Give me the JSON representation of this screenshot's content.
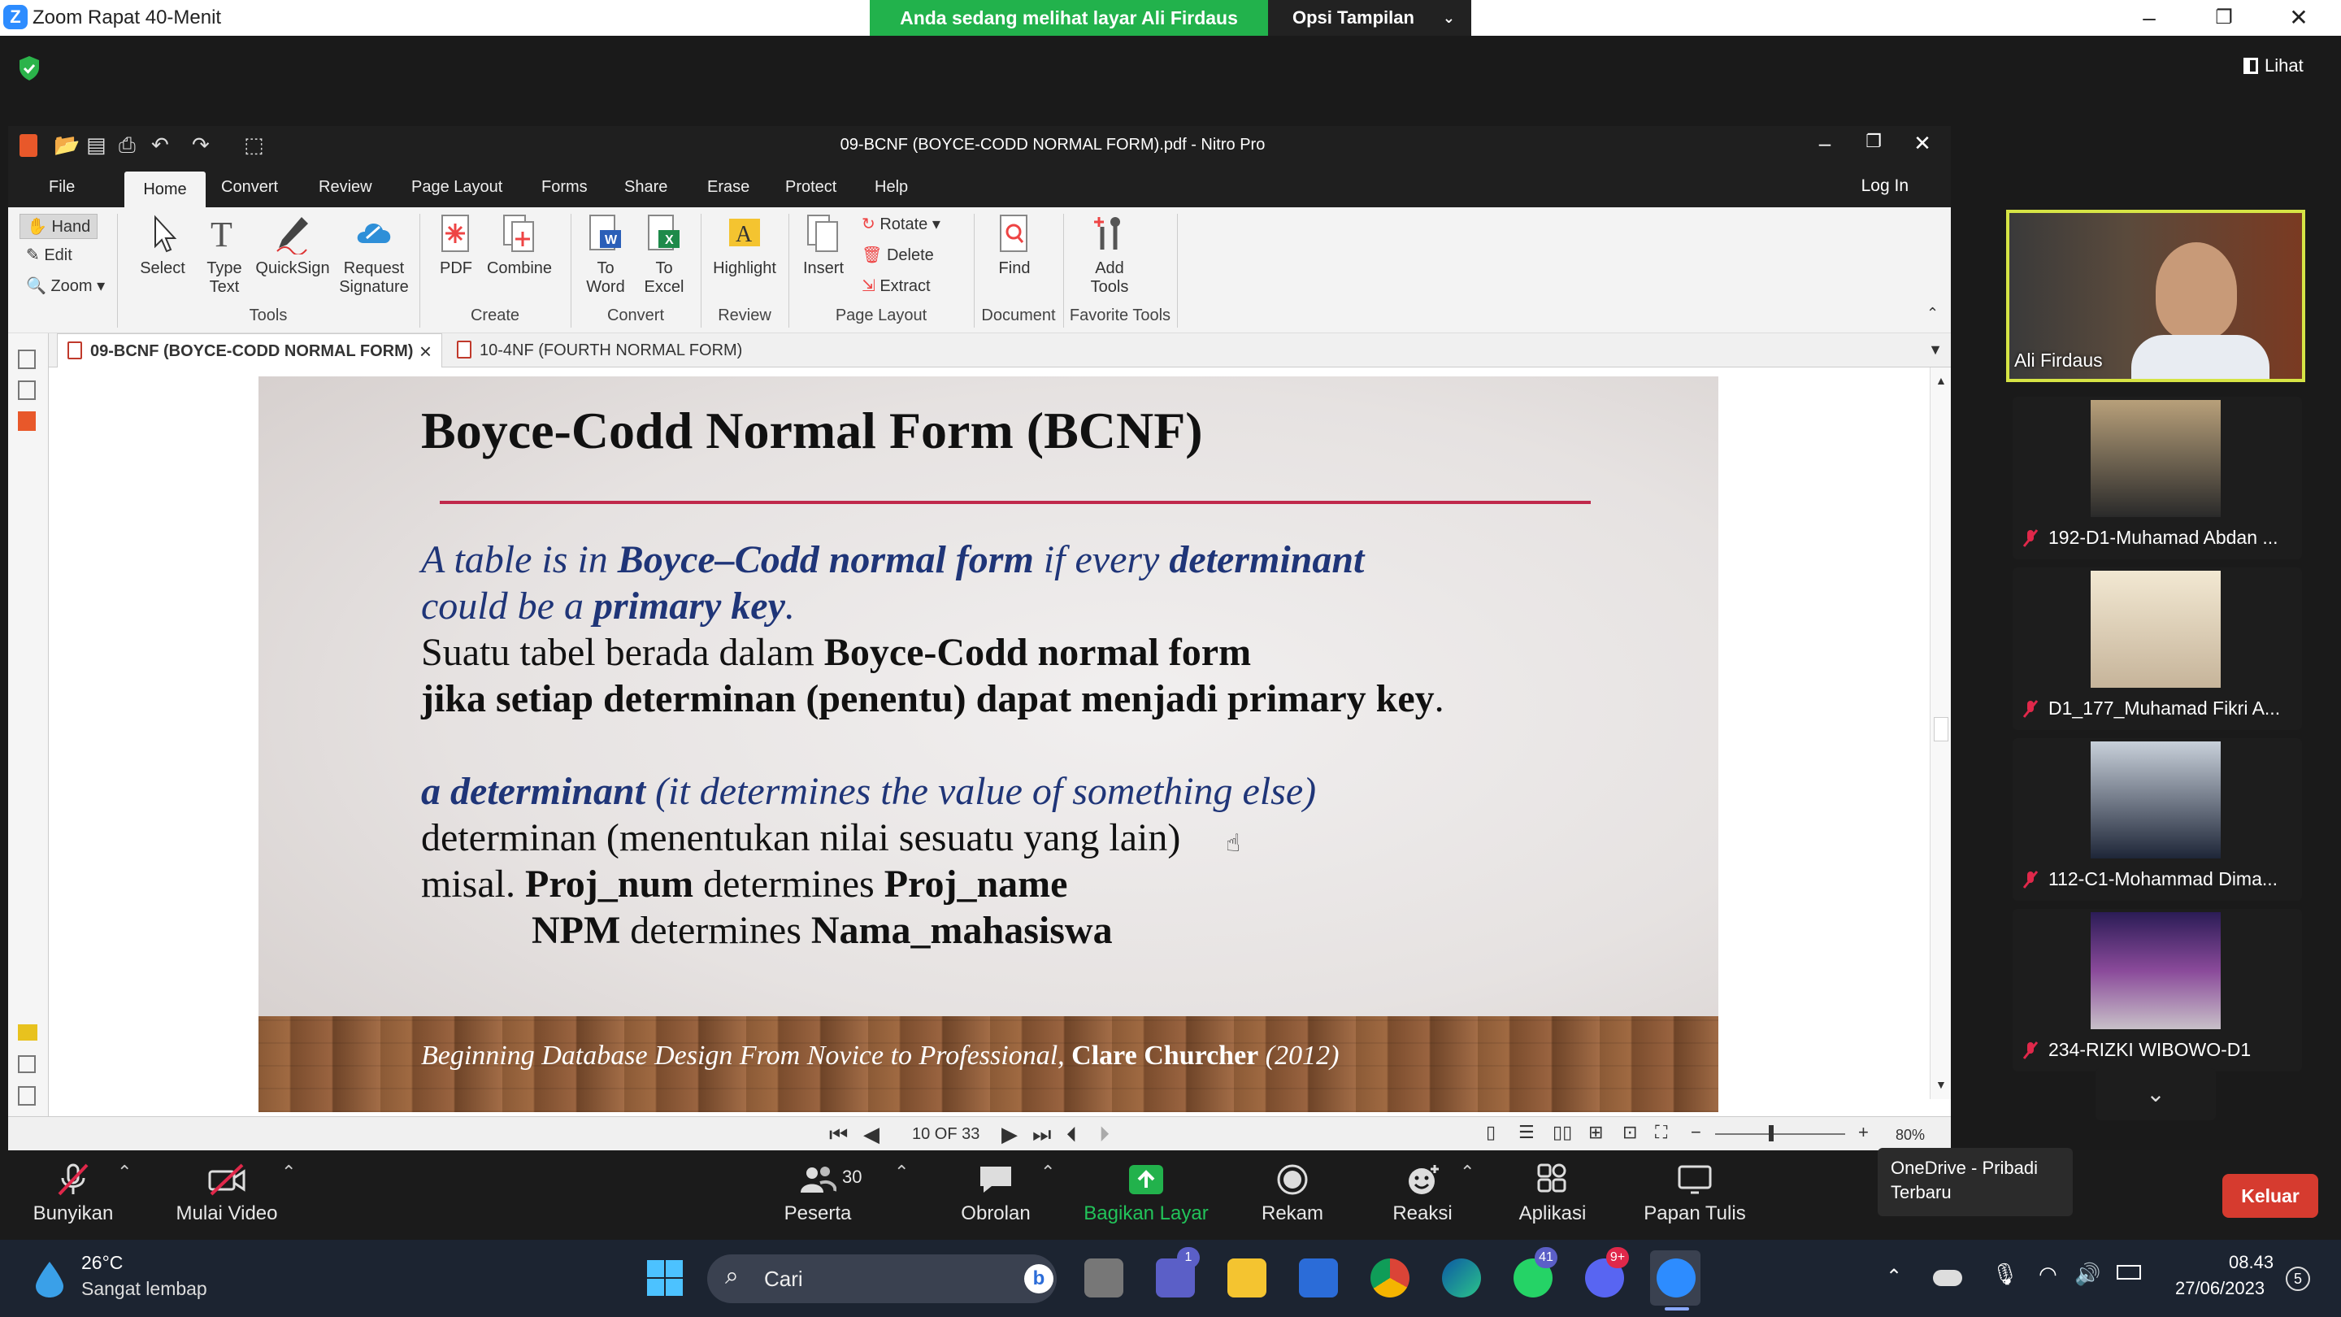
{
  "zoom": {
    "window_title": "Zoom Rapat 40-Menit",
    "share_banner": "Anda sedang melihat layar Ali Firdaus",
    "view_options": "Opsi Tampilan",
    "view_button": "Lihat"
  },
  "nitro": {
    "title": "09-BCNF (BOYCE-CODD NORMAL FORM).pdf - Nitro Pro",
    "menu_tabs": [
      "File",
      "Home",
      "Convert",
      "Review",
      "Page Layout",
      "Forms",
      "Share",
      "Erase",
      "Protect",
      "Help"
    ],
    "login": "Log In",
    "ribbon": {
      "hand": "Hand",
      "edit": "Edit",
      "zoom": "Zoom",
      "select": "Select",
      "type_text_1": "Type",
      "type_text_2": "Text",
      "quicksign": "QuickSign",
      "request_sig_1": "Request",
      "request_sig_2": "Signature",
      "tools_group": "Tools",
      "pdf": "PDF",
      "combine": "Combine",
      "create_group": "Create",
      "to_word_1": "To",
      "to_word_2": "Word",
      "to_excel_1": "To",
      "to_excel_2": "Excel",
      "convert_group": "Convert",
      "highlight": "Highlight",
      "review_group": "Review",
      "insert": "Insert",
      "rotate": "Rotate",
      "delete": "Delete",
      "extract": "Extract",
      "page_layout_group": "Page Layout",
      "find": "Find",
      "document_group": "Document",
      "add_tools_1": "Add",
      "add_tools_2": "Tools",
      "favorite_group": "Favorite Tools"
    },
    "doc_tabs": [
      "09-BCNF (BOYCE-CODD NORMAL FORM)",
      "10-4NF (FOURTH NORMAL FORM)"
    ],
    "page_indicator": "10 OF 33",
    "zoom_level": "80%"
  },
  "slide": {
    "title": "Boyce-Codd Normal Form (BCNF)",
    "l1a": "A table is in ",
    "l1b": "Boyce–Codd normal form",
    "l1c": " if every ",
    "l1d": "determinant",
    "l2a": "could be a ",
    "l2b": "primary key",
    "l2c": ".",
    "l3a": "Suatu tabel berada dalam ",
    "l3b": "Boyce-Codd normal form",
    "l4a": "jika setiap determinan (penentu) dapat menjadi primary key",
    "l4b": ".",
    "l5a": "a determinant",
    "l5b": " (it determines the value of something else)",
    "l6": "determinan (menentukan nilai sesuatu yang lain)",
    "l7a": "misal. ",
    "l7b": "Proj_num",
    "l7c": " determines ",
    "l7d": "Proj_name",
    "l8a": "NPM",
    "l8b": " determines ",
    "l8c": "Nama_mahasiswa",
    "cite_a": "Beginning Database Design From Novice to Professional, ",
    "cite_b": "Clare Churcher",
    "cite_c": " (2012)"
  },
  "participants": {
    "speaker": "Ali Firdaus",
    "others": [
      "192-D1-Muhamad Abdan ...",
      "D1_177_Muhamad Fikri A...",
      "112-C1-Mohammad Dima...",
      "234-RIZKI WIBOWO-D1"
    ]
  },
  "toolbar": {
    "unmute": "Bunyikan",
    "start_video": "Mulai Video",
    "participants": "Peserta",
    "participant_count": "30",
    "chat": "Obrolan",
    "share": "Bagikan Layar",
    "record": "Rekam",
    "reactions": "Reaksi",
    "apps": "Aplikasi",
    "whiteboard": "Papan Tulis",
    "leave": "Keluar"
  },
  "tooltip": {
    "line1": "OneDrive - Pribadi",
    "line2": "Terbaru"
  },
  "taskbar": {
    "temperature": "26°C",
    "weather": "Sangat lembap",
    "search": "Cari",
    "badges": {
      "teams": "1",
      "whatsapp": "41",
      "discord": "9+"
    },
    "time": "08.43",
    "date": "27/06/2023",
    "notif_count": "5"
  },
  "colors": {
    "accent_green": "#22b24c",
    "leave_red": "#d63b2f",
    "speaker_border": "#d6e445",
    "slide_rule": "#c0284b",
    "slide_blue": "#1f3578"
  }
}
